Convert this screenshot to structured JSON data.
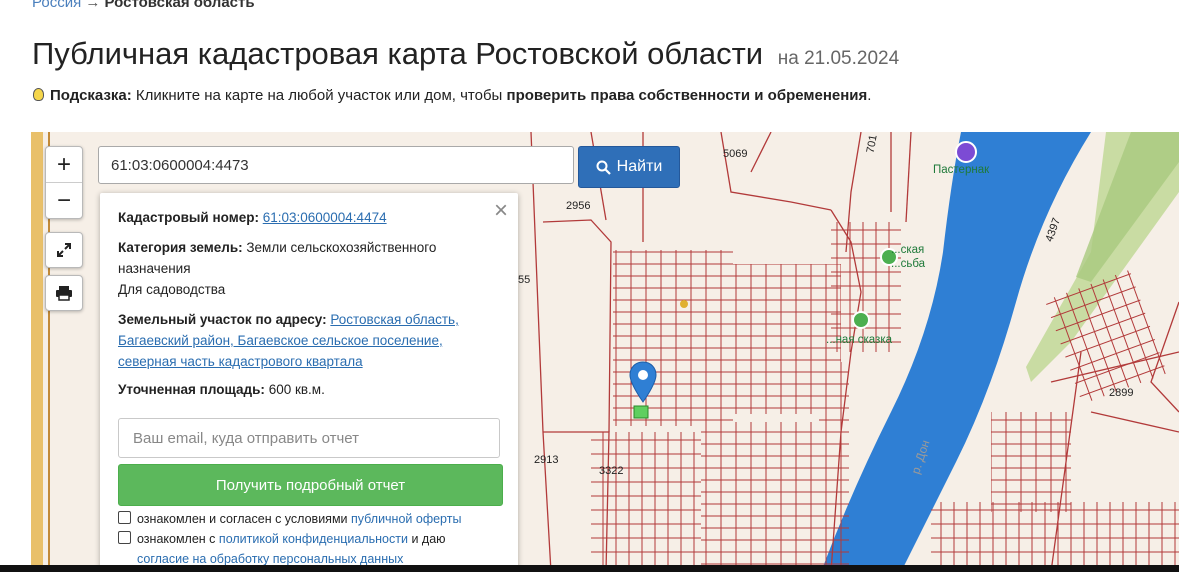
{
  "breadcrumb": {
    "link": "Россия",
    "separator": "→",
    "current": "Ростовская область"
  },
  "page": {
    "title": "Публичная кадастровая карта Ростовской области",
    "date_prefix": "на",
    "date": "21.05.2024"
  },
  "hint": {
    "label": "Подсказка:",
    "text": "Кликните на карте на любой участок или дом, чтобы",
    "emphasis": "проверить права собственности и обременения",
    "end": "."
  },
  "map": {
    "zoom_in": "+",
    "zoom_out": "−",
    "search_value": "61:03:0600004:4473",
    "find_button": "Найти",
    "icons": {
      "fullscreen": "fullscreen-icon",
      "print": "print-icon",
      "search": "search-icon",
      "pin": "map-pin-icon"
    },
    "labels": {
      "l5069": "5069",
      "l2956": "2956",
      "l55": "55",
      "l2913": "2913",
      "l3322": "3322",
      "l2899": "2899",
      "l4397": "4397",
      "l701": "701",
      "pasternak": "Пастернак",
      "usadba1": "...ская",
      "usadba2": "...сьба",
      "skazka": "...ная сказка",
      "river": "р. Дон"
    }
  },
  "popup": {
    "cadastral_label": "Кадастровый номер:",
    "cadastral_value": "61:03:0600004:4474",
    "category_label": "Категория земель:",
    "category_value": "Земли сельскохозяйственного назначения",
    "usage": "Для садоводства",
    "address_label": "Земельный участок по адресу:",
    "address_value": "Ростовская область, Багаевский район, Багаевское сельское поселение, северная часть кадастрового квартала",
    "area_label": "Уточненная площадь:",
    "area_value": "600 кв.м.",
    "email_placeholder": "Ваш email, куда отправить отчет",
    "report_button": "Получить подробный отчет",
    "consent1_text": "ознакомлен и согласен с условиями",
    "consent1_link": "публичной оферты",
    "consent2_text": "ознакомлен с",
    "consent2_link": "политикой конфиденциальности",
    "consent2_text2": "и даю",
    "consent2_link2": "согласие на обработку персональных данных"
  },
  "colors": {
    "accent": "#2f6fb8",
    "success": "#5cb85c",
    "parcel_line": "#b02a2a",
    "river": "#2f7fd4"
  }
}
